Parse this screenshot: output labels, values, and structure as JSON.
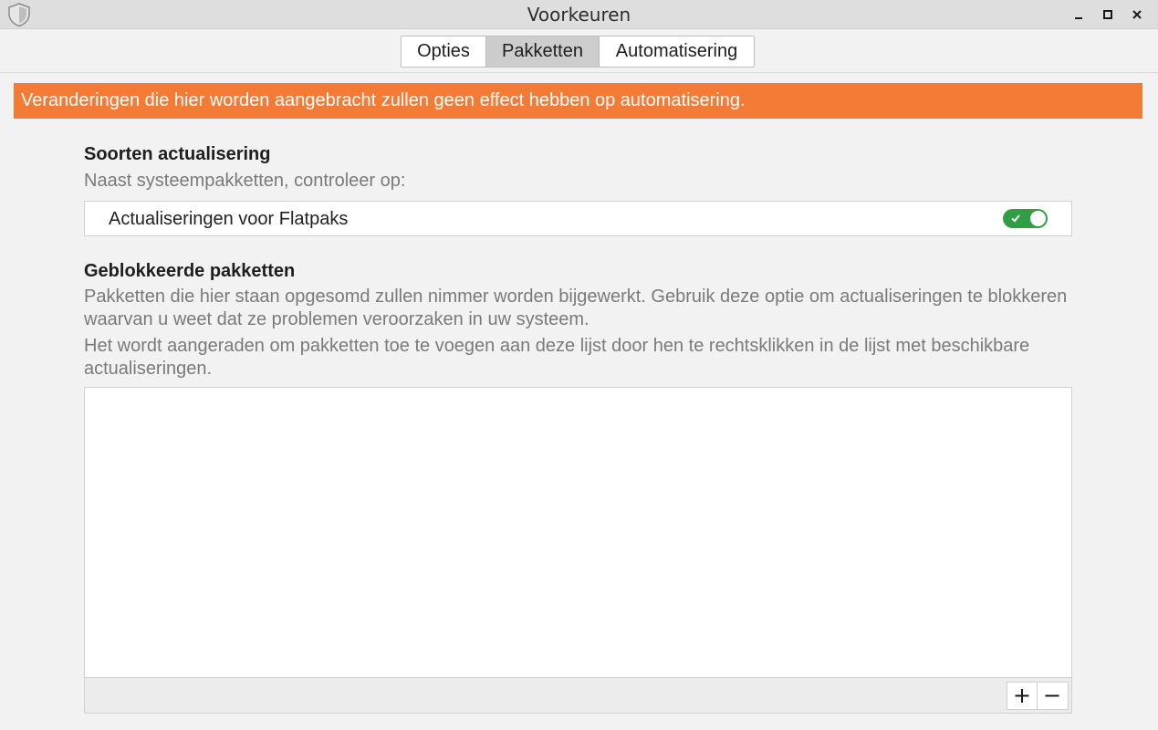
{
  "window": {
    "title": "Voorkeuren",
    "icon": "shield-icon",
    "controls": [
      "minimize-icon",
      "maximize-icon",
      "close-icon"
    ]
  },
  "tabs": [
    {
      "label": "Opties",
      "active": false
    },
    {
      "label": "Pakketten",
      "active": true
    },
    {
      "label": "Automatisering",
      "active": false
    }
  ],
  "warning": {
    "text": "Veranderingen die hier worden aangebracht zullen geen effect hebben op automatisering.",
    "color": "#f47b36"
  },
  "update_types": {
    "heading": "Soorten actualisering",
    "subtitle": "Naast systeempakketten, controleer op:",
    "flatpak_label": "Actualiseringen voor Flatpaks",
    "flatpak_enabled": true,
    "toggle_color": "#2f9e44"
  },
  "blocked": {
    "heading": "Geblokkeerde pakketten",
    "desc1": "Pakketten die hier staan opgesomd zullen nimmer worden bijgewerkt. Gebruik deze optie om actualiseringen te blokkeren waarvan u weet dat ze problemen veroorzaken in uw systeem.",
    "desc2": "Het wordt aangeraden om pakketten toe te voegen aan deze lijst door hen te rechtsklikken in de lijst met beschikbare actualiseringen.",
    "items": [],
    "add_icon": "plus-icon",
    "remove_icon": "minus-icon"
  }
}
